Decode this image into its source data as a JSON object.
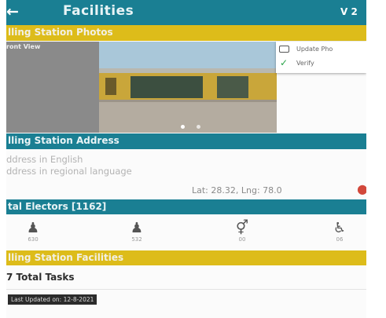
{
  "header": {
    "back_icon": "arrow-left-icon",
    "title": "Facilities",
    "version": "V 2"
  },
  "photos_section": {
    "title": "lling Station Photos",
    "front_label": "ront View",
    "menu": {
      "update_label": "Update Pho",
      "verify_label": "Verify"
    }
  },
  "address_section": {
    "title": "lling Station Address",
    "english": "ddress in English",
    "regional": "ddress in regional language",
    "latlng": "Lat: 28.32, Lng: 78.0"
  },
  "electors_section": {
    "title": "tal Electors [1162]",
    "categories": [
      {
        "icon": "male-icon",
        "count": "630"
      },
      {
        "icon": "female-icon",
        "count": "532"
      },
      {
        "icon": "third-gender-icon",
        "count": "00"
      },
      {
        "icon": "wheelchair-icon",
        "count": "06"
      }
    ]
  },
  "facilities_section": {
    "title": "lling Station Facilities",
    "tasks": "7 Total Tasks",
    "last_updated": "Last Updated on: 12-8-2021"
  },
  "colors": {
    "teal": "#1a7f93",
    "yellow": "#ddbc1a"
  }
}
